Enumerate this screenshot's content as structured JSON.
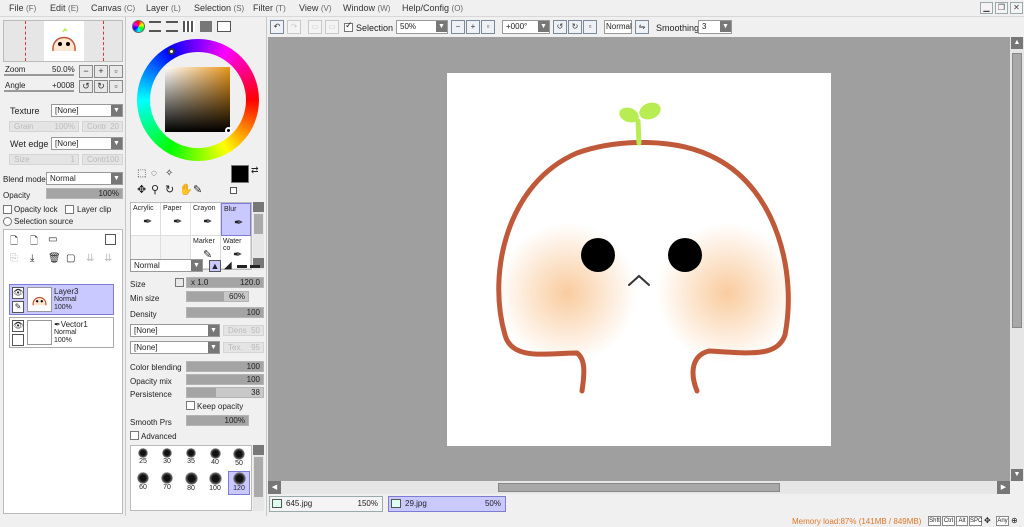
{
  "menu": [
    {
      "label": "File",
      "key": "(F)"
    },
    {
      "label": "Edit",
      "key": "(E)"
    },
    {
      "label": "Canvas",
      "key": "(C)"
    },
    {
      "label": "Layer",
      "key": "(L)"
    },
    {
      "label": "Selection",
      "key": "(S)"
    },
    {
      "label": "Filter",
      "key": "(T)"
    },
    {
      "label": "View",
      "key": "(V)"
    },
    {
      "label": "Window",
      "key": "(W)"
    },
    {
      "label": "Help/Config",
      "key": "(O)"
    }
  ],
  "navigator": {
    "zoom_label": "Zoom",
    "zoom_value": "50.0%",
    "angle_label": "Angle",
    "angle_value": "+0008"
  },
  "texture": {
    "label": "Texture",
    "value": "[None]",
    "grain_label": "Grain",
    "grain_value": "100%",
    "contr_label": "Contr",
    "contr_value": "20"
  },
  "wet_edge": {
    "label": "Wet edge",
    "value": "[None]",
    "size_label": "Size",
    "size_value": "1",
    "contr_label": "Contr",
    "contr_value": "100"
  },
  "blend_mode": {
    "label": "Blend mode",
    "value": "Normal"
  },
  "opacity": {
    "label": "Opacity",
    "value": "100%",
    "fraction": 1.0
  },
  "opacity_lock": "Opacity lock",
  "layer_clip": "Layer clip",
  "selection_source": "Selection source",
  "layers": [
    {
      "name": "Layer3",
      "mode": "Normal",
      "opacity": "100%",
      "selected": true
    },
    {
      "name": "Vector1",
      "mode": "Normal",
      "opacity": "100%",
      "selected": false
    }
  ],
  "tools_tabs": [
    "color-wheel",
    "rgb",
    "hsv",
    "swatch",
    "scratch"
  ],
  "brushes": [
    {
      "name": "Acrylic"
    },
    {
      "name": "Paper"
    },
    {
      "name": "Crayon"
    },
    {
      "name": "Blur",
      "selected": true
    },
    {
      "name": ""
    },
    {
      "name": ""
    },
    {
      "name": "Marker"
    },
    {
      "name": "Water co"
    }
  ],
  "brush_settings": {
    "mode": "Normal",
    "size_label": "Size",
    "size_mult": "x 1.0",
    "size_value": "120.0",
    "min_size_label": "Min size",
    "min_size_value": "60%",
    "min_size_fraction": 0.6,
    "density_label": "Density",
    "density_value": "100",
    "density_fraction": 1.0,
    "shape1": "[None]",
    "dens_label": "Dens",
    "dens_value": "50",
    "shape2": "[None]",
    "tex_label": "Tex.",
    "tex_value": "95",
    "color_blending_label": "Color blending",
    "color_blending_value": "100",
    "color_blending_fraction": 1.0,
    "opacity_mix_label": "Opacity mix",
    "opacity_mix_value": "100",
    "opacity_mix_fraction": 1.0,
    "persistence_label": "Persistence",
    "persistence_value": "38",
    "persistence_fraction": 0.38,
    "keep_opacity": "Keep opacity",
    "smooth_prs_label": "Smooth Prs",
    "smooth_prs_value": "100%",
    "smooth_prs_fraction": 1.0,
    "advanced": "Advanced"
  },
  "brush_sizes": [
    "25",
    "30",
    "35",
    "40",
    "50",
    "60",
    "70",
    "80",
    "100",
    "120"
  ],
  "selected_brush_size": "120",
  "toolbar": {
    "selection_label": "Selection",
    "zoom_value": "50%",
    "rotation_value": "+000°",
    "blend_value": "Normal",
    "smoothing_label": "Smoothing",
    "smoothing_value": "3"
  },
  "documents": [
    {
      "name": "645.jpg",
      "zoom": "150%",
      "active": false
    },
    {
      "name": "29.jpg",
      "zoom": "50%",
      "active": true
    }
  ],
  "status": {
    "memory": "Memory load:87% (141MB / 849MB)",
    "keys": [
      "Shft",
      "Ctrl",
      "Alt",
      "SPC",
      "Any"
    ]
  },
  "colors": {
    "accent": "#c9c8ff",
    "outline": "#c0583a",
    "sprout": "#b7ec52",
    "blush": "#f9c999",
    "memory_text": "#e0782a"
  }
}
